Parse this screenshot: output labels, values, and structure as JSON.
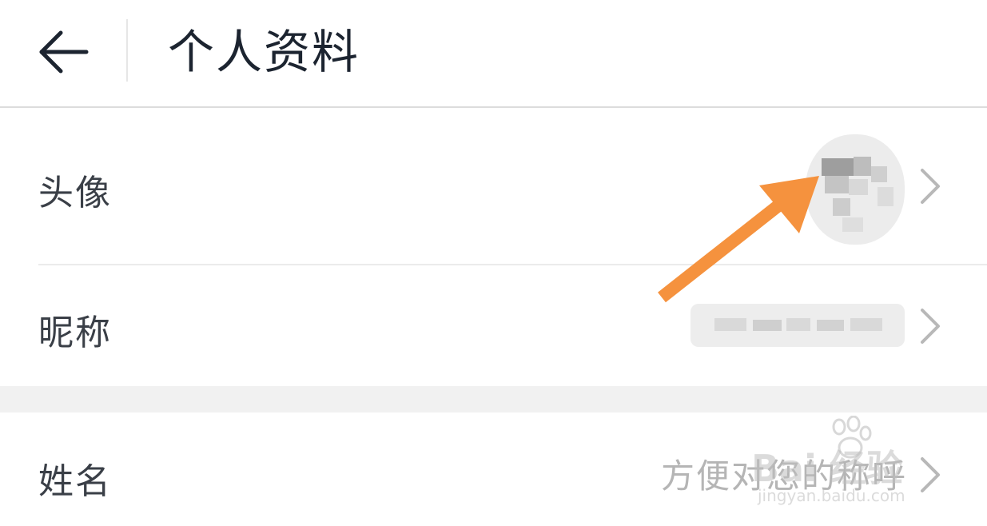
{
  "header": {
    "title": "个人资料",
    "back_icon": "arrow-left-icon"
  },
  "rows": [
    {
      "label": "头像",
      "value_type": "image",
      "chevron_icon": "chevron-right-icon"
    },
    {
      "label": "昵称",
      "value_type": "text",
      "chevron_icon": "chevron-right-icon"
    },
    {
      "label": "姓名",
      "placeholder": "方便对您的称呼",
      "chevron_icon": "chevron-right-icon"
    }
  ],
  "colors": {
    "title": "#1c2430",
    "label": "#3a3f47",
    "placeholder": "#b5b5b5",
    "divider": "#ebebeb",
    "section_gap": "#f1f1f1",
    "annotation_arrow": "#f5923e"
  },
  "watermark": {
    "logo_text": "Bai 经验",
    "site": "jingyan.baidu.com"
  }
}
